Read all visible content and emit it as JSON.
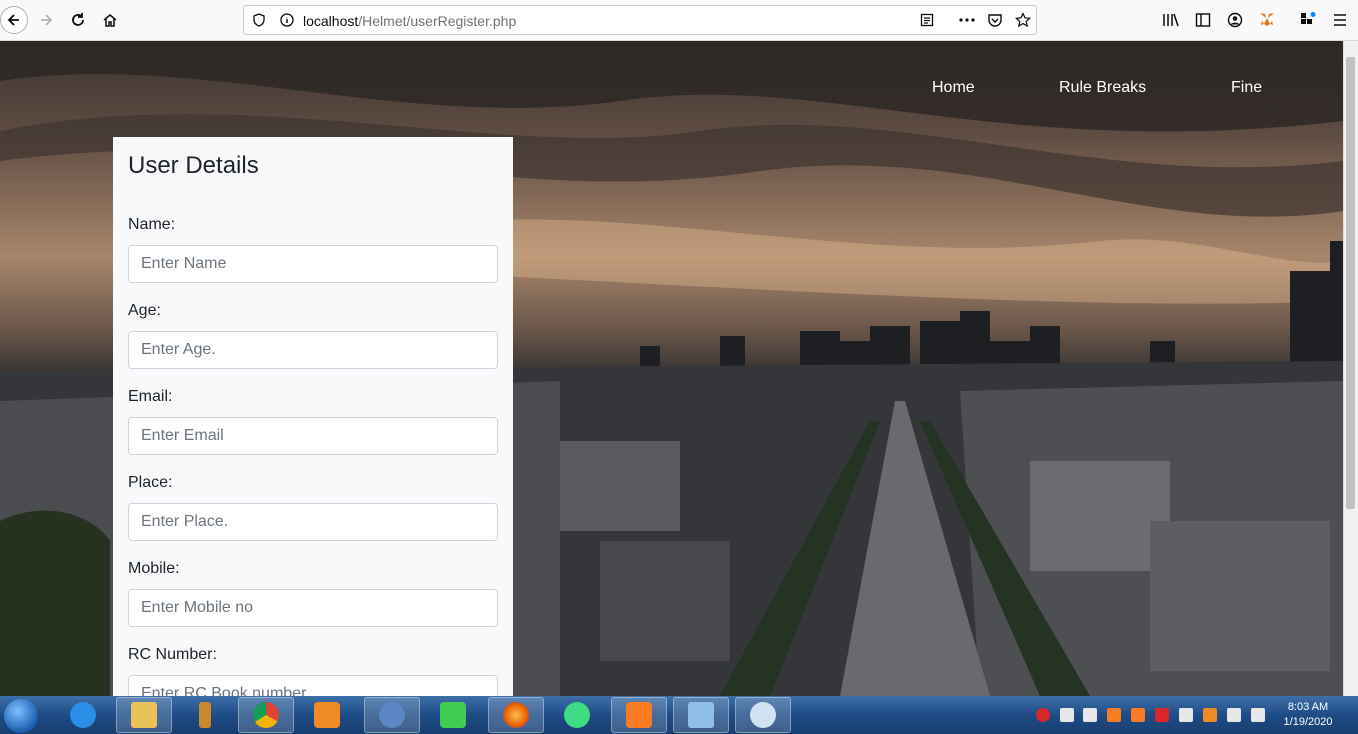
{
  "browser": {
    "url_host": "localhost",
    "url_path": "/Helmet/userRegister.php"
  },
  "nav": {
    "home": "Home",
    "rule_breaks": "Rule Breaks",
    "fine": "Fine"
  },
  "form": {
    "title": "User Details",
    "fields": [
      {
        "label": "Name:",
        "placeholder": "Enter Name",
        "value": ""
      },
      {
        "label": "Age:",
        "placeholder": "Enter Age.",
        "value": ""
      },
      {
        "label": "Email:",
        "placeholder": "Enter Email",
        "value": ""
      },
      {
        "label": "Place:",
        "placeholder": "Enter Place.",
        "value": ""
      },
      {
        "label": "Mobile:",
        "placeholder": "Enter Mobile no",
        "value": ""
      },
      {
        "label": "RC Number:",
        "placeholder": "Enter RC Book number",
        "value": ""
      }
    ]
  },
  "taskbar": {
    "apps": [
      "internet-explorer",
      "file-explorer",
      "microscope-app",
      "chrome",
      "media-player",
      "qgis-app",
      "qt-creator",
      "firefox",
      "android-studio",
      "xampp",
      "virtualbox",
      "paint"
    ],
    "clock_time": "8:03 AM",
    "clock_date": "1/19/2020"
  },
  "colors": {
    "panel_bg": "#f8f9fa",
    "taskbar": "#1f4c86"
  }
}
